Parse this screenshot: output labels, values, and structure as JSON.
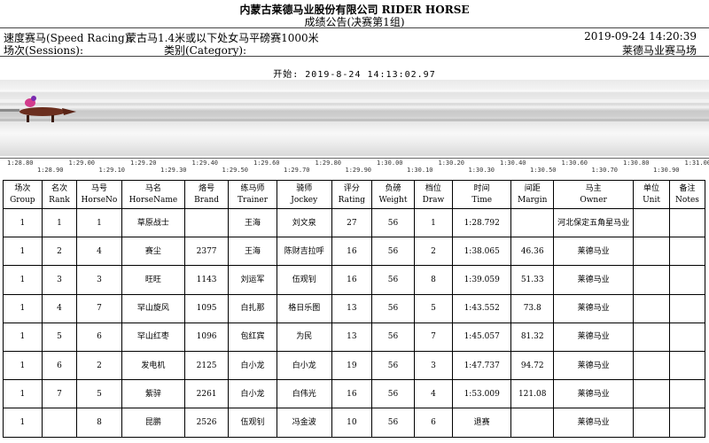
{
  "header": {
    "company": "内蒙古莱德马业股份有限公司 RIDER HORSE",
    "subtitle": "成绩公告(决赛第1组)",
    "race_label": "速度赛马(Speed Racing):",
    "race_name": "蒙古马1.4米或以下处女马平磅赛1000米",
    "datetime": "2019-09-24  14:20:39",
    "sessions_label": "场次(Sessions):",
    "category_label": "类别(Category):",
    "venue": "莱德马业赛马场"
  },
  "photo_finish": {
    "start_text": "开始: 2019-8-24 14:13:02.97",
    "timeline_top": [
      "1:28.80",
      "1:29.00",
      "1:29.20",
      "1:29.40",
      "1:29.60",
      "1:29.80",
      "1:30.00",
      "1:30.20",
      "1:30.40",
      "1:30.60",
      "1:30.80",
      "1:31.00"
    ],
    "timeline_bottom": [
      "1:28.90",
      "1:29.10",
      "1:29.30",
      "1:29.50",
      "1:29.70",
      "1:29.90",
      "1:30.10",
      "1:30.30",
      "1:30.50",
      "1:30.70",
      "1:30.90"
    ]
  },
  "table": {
    "columns": [
      {
        "cn": "场次",
        "en": "Group"
      },
      {
        "cn": "名次",
        "en": "Rank"
      },
      {
        "cn": "马号",
        "en": "HorseNo"
      },
      {
        "cn": "马名",
        "en": "HorseName"
      },
      {
        "cn": "烙号",
        "en": "Brand"
      },
      {
        "cn": "练马师",
        "en": "Trainer"
      },
      {
        "cn": "骑师",
        "en": "Jockey"
      },
      {
        "cn": "评分",
        "en": "Rating"
      },
      {
        "cn": "负磅",
        "en": "Weight"
      },
      {
        "cn": "档位",
        "en": "Draw"
      },
      {
        "cn": "时间",
        "en": "Time"
      },
      {
        "cn": "间距",
        "en": "Margin"
      },
      {
        "cn": "马主",
        "en": "Owner"
      },
      {
        "cn": "单位",
        "en": "Unit"
      },
      {
        "cn": "备注",
        "en": "Notes"
      }
    ],
    "rows": [
      [
        "1",
        "1",
        "1",
        "草原战士",
        "",
        "王海",
        "刘文泉",
        "27",
        "56",
        "1",
        "1:28.792",
        "",
        "河北保定五角星马业",
        "",
        ""
      ],
      [
        "1",
        "2",
        "4",
        "赛尘",
        "2377",
        "王海",
        "陈财吉拉呼",
        "16",
        "56",
        "2",
        "1:38.065",
        "46.36",
        "莱德马业",
        "",
        ""
      ],
      [
        "1",
        "3",
        "3",
        "旺旺",
        "1143",
        "刘运军",
        "伍观钊",
        "16",
        "56",
        "8",
        "1:39.059",
        "51.33",
        "莱德马业",
        "",
        ""
      ],
      [
        "1",
        "4",
        "7",
        "罕山旋风",
        "1095",
        "白扎那",
        "格日乐图",
        "13",
        "56",
        "5",
        "1:43.552",
        "73.8",
        "莱德马业",
        "",
        ""
      ],
      [
        "1",
        "5",
        "6",
        "罕山红枣",
        "1096",
        "包红宾",
        "为民",
        "13",
        "56",
        "7",
        "1:45.057",
        "81.32",
        "莱德马业",
        "",
        ""
      ],
      [
        "1",
        "6",
        "2",
        "发电机",
        "2125",
        "白小龙",
        "白小龙",
        "19",
        "56",
        "3",
        "1:47.737",
        "94.72",
        "莱德马业",
        "",
        ""
      ],
      [
        "1",
        "7",
        "5",
        "紫骍",
        "2261",
        "白小龙",
        "白伟光",
        "16",
        "56",
        "4",
        "1:53.009",
        "121.08",
        "莱德马业",
        "",
        ""
      ],
      [
        "1",
        "",
        "8",
        "昆鹏",
        "2526",
        "伍观钊",
        "冯金波",
        "10",
        "56",
        "6",
        "退赛",
        "",
        "莱德马业",
        "",
        ""
      ]
    ]
  }
}
